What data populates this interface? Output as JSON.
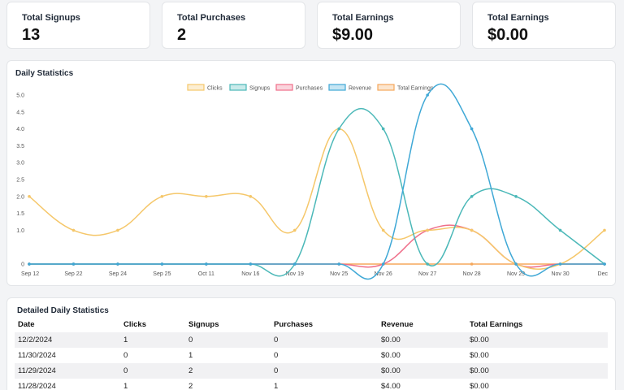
{
  "stats": [
    {
      "label": "Total Signups",
      "value": "13"
    },
    {
      "label": "Total Purchases",
      "value": "2"
    },
    {
      "label": "Total Earnings",
      "value": "$9.00"
    },
    {
      "label": "Total Earnings",
      "value": "$0.00"
    }
  ],
  "chart_section": {
    "title": "Daily Statistics"
  },
  "table_section": {
    "title": "Detailed Daily Statistics"
  },
  "colors": {
    "clicks": "#f5c76a",
    "signups": "#4bb8b8",
    "purchases": "#ef6f8a",
    "revenue": "#3fa8d6",
    "total_earnings": "#f5a85c"
  },
  "chart_data": {
    "type": "line",
    "categories": [
      "Sep 12",
      "Sep 22",
      "Sep 24",
      "Sep 25",
      "Oct 11",
      "Nov 16",
      "Nov 19",
      "Nov 25",
      "Nov 26",
      "Nov 27",
      "Nov 28",
      "Nov 29",
      "Nov 30",
      "Dec"
    ],
    "ylim": [
      0,
      5
    ],
    "yticks": [
      "0",
      "1.0",
      "1.5",
      "2.0",
      "2.5",
      "3.0",
      "3.5",
      "4.0",
      "4.5",
      "5.0"
    ],
    "legend_position": "top",
    "series": [
      {
        "name": "Clicks",
        "key": "clicks",
        "values": [
          2,
          1,
          1,
          2,
          2,
          2,
          1,
          4,
          1,
          1,
          1,
          0,
          0,
          1
        ]
      },
      {
        "name": "Signups",
        "key": "signups",
        "values": [
          0,
          0,
          0,
          0,
          0,
          0,
          0,
          4,
          4,
          0,
          2,
          2,
          1,
          0
        ]
      },
      {
        "name": "Purchases",
        "key": "purchases",
        "values": [
          0,
          0,
          0,
          0,
          0,
          0,
          0,
          0,
          0,
          1,
          1,
          0,
          0,
          0
        ]
      },
      {
        "name": "Revenue",
        "key": "revenue",
        "values": [
          0,
          0,
          0,
          0,
          0,
          0,
          0,
          0,
          0,
          5,
          4,
          0,
          0,
          0
        ]
      },
      {
        "name": "Total Earnings",
        "key": "total_earnings",
        "values": [
          0,
          0,
          0,
          0,
          0,
          0,
          0,
          0,
          0,
          0,
          0,
          0,
          0,
          0
        ]
      }
    ]
  },
  "table": {
    "headers": [
      "Date",
      "Clicks",
      "Signups",
      "Purchases",
      "Revenue",
      "Total Earnings"
    ],
    "rows": [
      [
        "12/2/2024",
        "1",
        "0",
        "0",
        "$0.00",
        "$0.00"
      ],
      [
        "11/30/2024",
        "0",
        "1",
        "0",
        "$0.00",
        "$0.00"
      ],
      [
        "11/29/2024",
        "0",
        "2",
        "0",
        "$0.00",
        "$0.00"
      ],
      [
        "11/28/2024",
        "1",
        "2",
        "1",
        "$4.00",
        "$0.00"
      ]
    ]
  }
}
